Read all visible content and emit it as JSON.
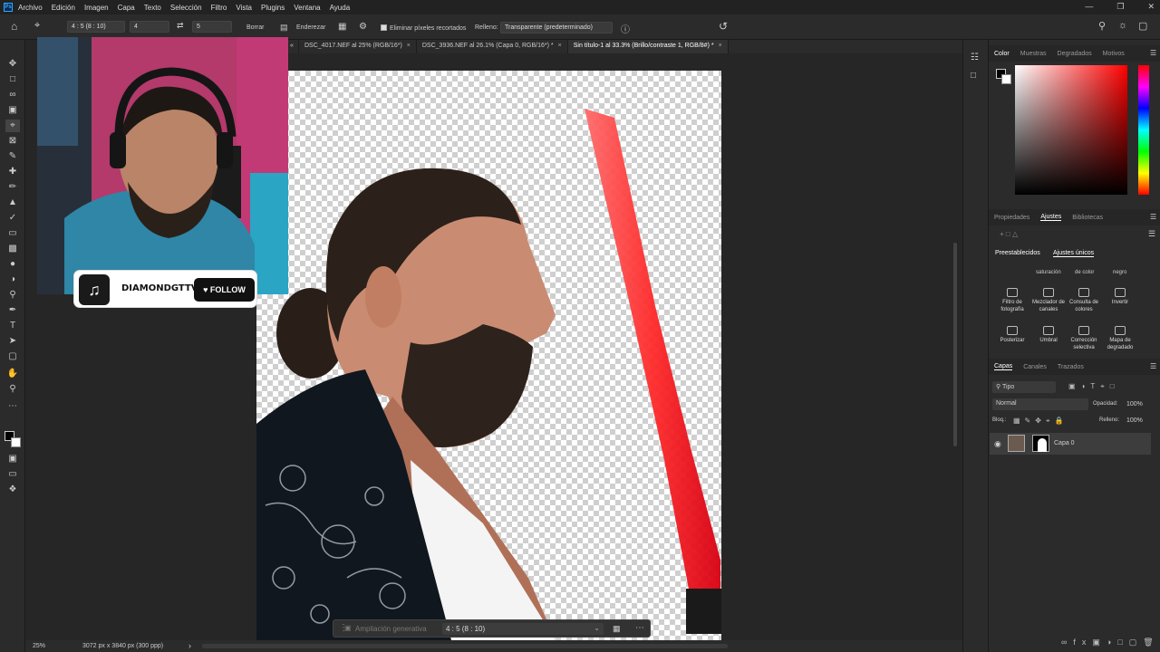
{
  "menubar": {
    "logo": "Ps",
    "items": [
      "Archivo",
      "Edición",
      "Imagen",
      "Capa",
      "Texto",
      "Selección",
      "Filtro",
      "Vista",
      "Plugins",
      "Ventana",
      "Ayuda"
    ]
  },
  "options": {
    "ratio": "4 : 5 (8 : 10)",
    "width_value": "4",
    "height_value": "5",
    "clear_label": "Borrar",
    "straighten_label": "Enderezar",
    "delete_cropped_label": "Eliminar píxeles recortados",
    "fill_label": "Relleno:",
    "fill_value": "Transparente (predeterminado)"
  },
  "doc_tabs": [
    "DSC_4017.NEF al 25% (RGB/16*)",
    "DSC_3936.NEF al 26.1% (Capa 0, RGB/16*) *",
    "Sin título-1 al 33.3% (Brillo/contraste 1, RGB/8#) *"
  ],
  "webcam": {
    "name": "DIAMONDGTTV",
    "follow": "FOLLOW"
  },
  "taskbar": {
    "generative": "Ampliación generativa",
    "ratio": "4 : 5 (8 : 10)"
  },
  "status": {
    "zoom": "25%",
    "size": "3072 px x 3840 px (300 ppp)"
  },
  "color_panel": {
    "tabs": [
      "Color",
      "Muestras",
      "Degradados",
      "Motivos"
    ]
  },
  "props_panel": {
    "tabs": [
      "Propiedades",
      "Ajustes",
      "Bibliotecas"
    ],
    "subtabs": [
      "Preestablecidos",
      "Ajustes únicos"
    ],
    "cut_row": [
      "saturación",
      "de color",
      "negro"
    ],
    "row1": [
      "Filtro de fotografía",
      "Mezclador de canales",
      "Consulta de colores",
      "Invertir"
    ],
    "row2": [
      "Posterizar",
      "Umbral",
      "Corrección selectiva",
      "Mapa de degradado"
    ]
  },
  "layers_panel": {
    "tabs": [
      "Capas",
      "Canales",
      "Trazados"
    ],
    "filter": "Tipo",
    "blend": "Normal",
    "opacity_label": "Opacidad:",
    "opacity_value": "100%",
    "lock_label": "Bloq.:",
    "fill_label": "Relleno:",
    "fill_value": "100%",
    "layer_name": "Capa 0"
  }
}
